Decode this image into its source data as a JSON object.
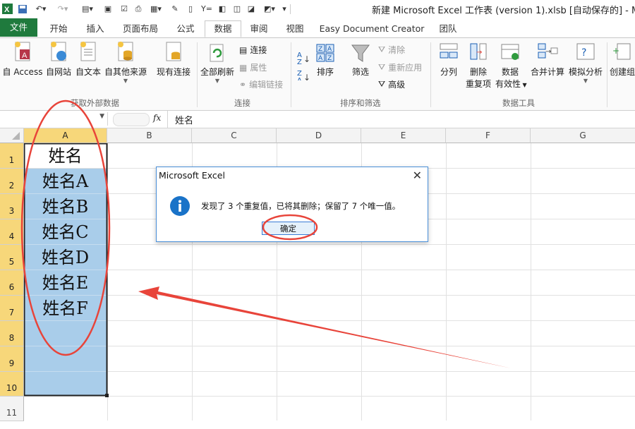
{
  "window": {
    "title": "新建 Microsoft Excel 工作表 (version 1).xlsb [自动保存的] - Micros"
  },
  "tabs": {
    "file": "文件",
    "items": [
      "开始",
      "插入",
      "页面布局",
      "公式",
      "数据",
      "审阅",
      "视图",
      "Easy Document Creator",
      "团队"
    ],
    "active": "数据"
  },
  "ribbon": {
    "get_external": {
      "from_access": "自 Access",
      "from_web": "自网站",
      "from_text": "自文本",
      "from_other": "自其他来源",
      "existing": "现有连接",
      "group_label": "获取外部数据"
    },
    "connections": {
      "refresh_all": "全部刷新",
      "connections": "连接",
      "properties": "属性",
      "edit_links": "编辑链接",
      "group_label": "连接"
    },
    "sort_filter": {
      "sort": "排序",
      "filter": "筛选",
      "clear": "清除",
      "reapply": "重新应用",
      "advanced": "高级",
      "group_label": "排序和筛选"
    },
    "data_tools": {
      "text_to_columns": "分列",
      "remove_dup_1": "删除",
      "remove_dup_2": "重复项",
      "validation_1": "数据",
      "validation_2": "有效性",
      "consolidate": "合并计算",
      "what_if": "模拟分析",
      "group_label": "数据工具"
    },
    "outline": {
      "create_group": "创建组"
    }
  },
  "formula_bar": {
    "fx": "fx",
    "content": "姓名"
  },
  "columns": [
    "A",
    "B",
    "C",
    "D",
    "E",
    "F",
    "G"
  ],
  "rows": [
    "1",
    "2",
    "3",
    "4",
    "5",
    "6",
    "7",
    "8",
    "9",
    "10",
    "11"
  ],
  "cells_A": [
    "姓名",
    "姓名A",
    "姓名B",
    "姓名C",
    "姓名D",
    "姓名E",
    "姓名F"
  ],
  "dialog": {
    "title": "Microsoft Excel",
    "close": "✕",
    "message": "发现了 3 个重复值，已将其删除；保留了 7 个唯一值。",
    "ok": "确定"
  },
  "colors": {
    "file_tab": "#1f7a3d",
    "selection": "#a9cdea",
    "header_highlight": "#f7d77a",
    "annotation": "#e8443a",
    "info_icon": "#1a73c8"
  }
}
